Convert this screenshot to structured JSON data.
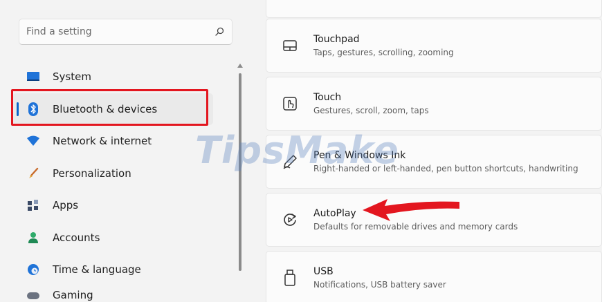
{
  "search": {
    "placeholder": "Find a setting",
    "icon": "search-icon"
  },
  "sidebar": {
    "items": [
      {
        "label": "System",
        "icon": "monitor-icon"
      },
      {
        "label": "Bluetooth & devices",
        "icon": "bluetooth-icon",
        "selected": true
      },
      {
        "label": "Network & internet",
        "icon": "wifi-icon"
      },
      {
        "label": "Personalization",
        "icon": "brush-icon"
      },
      {
        "label": "Apps",
        "icon": "apps-icon"
      },
      {
        "label": "Accounts",
        "icon": "person-icon"
      },
      {
        "label": "Time & language",
        "icon": "globe-clock-icon"
      },
      {
        "label": "Gaming",
        "icon": "controller-icon"
      }
    ]
  },
  "cards": [
    {
      "title": "Touchpad",
      "desc": "Taps, gestures, scrolling, zooming",
      "icon": "touchpad-icon"
    },
    {
      "title": "Touch",
      "desc": "Gestures, scroll, zoom, taps",
      "icon": "touch-icon"
    },
    {
      "title": "Pen & Windows Ink",
      "desc": "Right-handed or left-handed, pen button shortcuts, handwriting",
      "icon": "pen-icon"
    },
    {
      "title": "AutoPlay",
      "desc": "Defaults for removable drives and memory cards",
      "icon": "autoplay-icon"
    },
    {
      "title": "USB",
      "desc": "Notifications, USB battery saver",
      "icon": "usb-icon"
    }
  ],
  "watermark": "TipsMake",
  "colors": {
    "accent": "#0a64c8",
    "highlight_red": "#e3161f",
    "background": "#f3f3f3",
    "card": "#fbfbfb"
  }
}
